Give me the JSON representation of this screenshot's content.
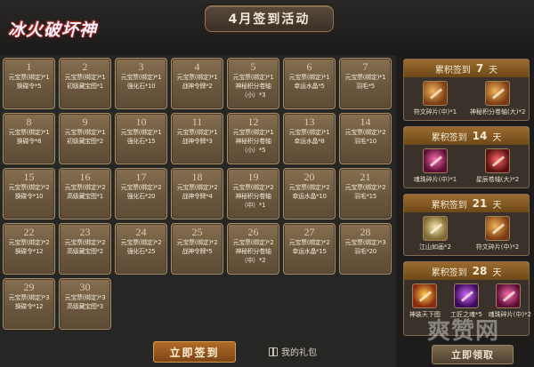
{
  "header": {
    "logo_text": "冰火破坏神",
    "title": "4月签到活动"
  },
  "days": [
    {
      "day": "1",
      "lines": [
        "元宝票(绑定)*1",
        "换碟令*5"
      ]
    },
    {
      "day": "2",
      "lines": [
        "元宝票(绑定)*1",
        "初级藏宝图*1"
      ]
    },
    {
      "day": "3",
      "lines": [
        "元宝票(绑定)*1",
        "强化石*10"
      ]
    },
    {
      "day": "4",
      "lines": [
        "元宝票(绑定)*1",
        "战神令牌*2"
      ]
    },
    {
      "day": "5",
      "lines": [
        "元宝票(绑定)*1",
        "神秘积分卷轴",
        "（小）*3"
      ]
    },
    {
      "day": "6",
      "lines": [
        "元宝票(绑定)*1",
        "幸运水晶*5"
      ]
    },
    {
      "day": "7",
      "lines": [
        "元宝票(绑定)*1",
        "羽毛*5"
      ]
    },
    {
      "day": "8",
      "lines": [
        "元宝票(绑定)*1",
        "换碟令*8"
      ]
    },
    {
      "day": "9",
      "lines": [
        "元宝票(绑定)*1",
        "初级藏宝图*2"
      ]
    },
    {
      "day": "10",
      "lines": [
        "元宝票(绑定)*1",
        "强化石*15"
      ]
    },
    {
      "day": "11",
      "lines": [
        "元宝票(绑定)*1",
        "战神令牌*3"
      ]
    },
    {
      "day": "12",
      "lines": [
        "元宝票(绑定)*1",
        "神秘积分卷轴",
        "（小）*5"
      ]
    },
    {
      "day": "13",
      "lines": [
        "元宝票(绑定)*1",
        "幸运水晶*8"
      ]
    },
    {
      "day": "14",
      "lines": [
        "元宝票(绑定)*2",
        "羽毛*10"
      ]
    },
    {
      "day": "15",
      "lines": [
        "元宝票(绑定)*2",
        "换碟令*10"
      ]
    },
    {
      "day": "16",
      "lines": [
        "元宝票(绑定)*2",
        "高级藏宝图*1"
      ]
    },
    {
      "day": "17",
      "lines": [
        "元宝票(绑定)*2",
        "强化石*20"
      ]
    },
    {
      "day": "18",
      "lines": [
        "元宝票(绑定)*2",
        "战神令牌*4"
      ]
    },
    {
      "day": "19",
      "lines": [
        "元宝票(绑定)*2",
        "神秘积分卷轴",
        "（中）*1"
      ]
    },
    {
      "day": "20",
      "lines": [
        "元宝票(绑定)*2",
        "幸运水晶*10"
      ]
    },
    {
      "day": "21",
      "lines": [
        "元宝票(绑定)*2",
        "羽毛*15"
      ]
    },
    {
      "day": "22",
      "lines": [
        "元宝票(绑定)*2",
        "换碟令*12"
      ]
    },
    {
      "day": "23",
      "lines": [
        "元宝票(绑定)*2",
        "高级藏宝图*2"
      ]
    },
    {
      "day": "24",
      "lines": [
        "元宝票(绑定)*2",
        "强化石*25"
      ]
    },
    {
      "day": "25",
      "lines": [
        "元宝票(绑定)*2",
        "战神令牌*5"
      ]
    },
    {
      "day": "26",
      "lines": [
        "元宝票(绑定)*2",
        "神秘积分卷轴",
        "（中）*2"
      ]
    },
    {
      "day": "27",
      "lines": [
        "元宝票(绑定)*2",
        "幸运水晶*15"
      ]
    },
    {
      "day": "28",
      "lines": [
        "元宝票(绑定)*3",
        "羽毛*20"
      ]
    },
    {
      "day": "29",
      "lines": [
        "元宝票(绑定)*3",
        "换碟令*12"
      ]
    },
    {
      "day": "30",
      "lines": [
        "元宝票(绑定)*3",
        "高级藏宝图*3"
      ]
    }
  ],
  "buttons": {
    "sign_in": "立即签到",
    "my_gift": "我的礼包",
    "claim": "立即领取"
  },
  "cumulative": [
    {
      "prefix": "累积签到",
      "num": "7",
      "suffix": "天",
      "items": [
        {
          "name": "符文碎片(中)*1",
          "icon": "gold"
        },
        {
          "name": "神秘积分卷轴(大)*2",
          "icon": "gold"
        }
      ]
    },
    {
      "prefix": "累积签到",
      "num": "14",
      "suffix": "天",
      "items": [
        {
          "name": "魂珠碎片(中)*1",
          "icon": "pink"
        },
        {
          "name": "星辰卷轴(大)*2",
          "icon": "red"
        }
      ]
    },
    {
      "prefix": "累积签到",
      "num": "21",
      "suffix": "天",
      "items": [
        {
          "name": "江山如画*2",
          "icon": "scroll"
        },
        {
          "name": "符文碎片(中)*2",
          "icon": "gold"
        }
      ]
    },
    {
      "prefix": "累积签到",
      "num": "28",
      "suffix": "天",
      "items": [
        {
          "name": "神装天下图",
          "icon": "badge"
        },
        {
          "name": "工匠之魂*5",
          "icon": "violet"
        },
        {
          "name": "魂珠碎片(中)*2",
          "icon": "pink"
        }
      ]
    }
  ],
  "watermark": "爽赞网"
}
